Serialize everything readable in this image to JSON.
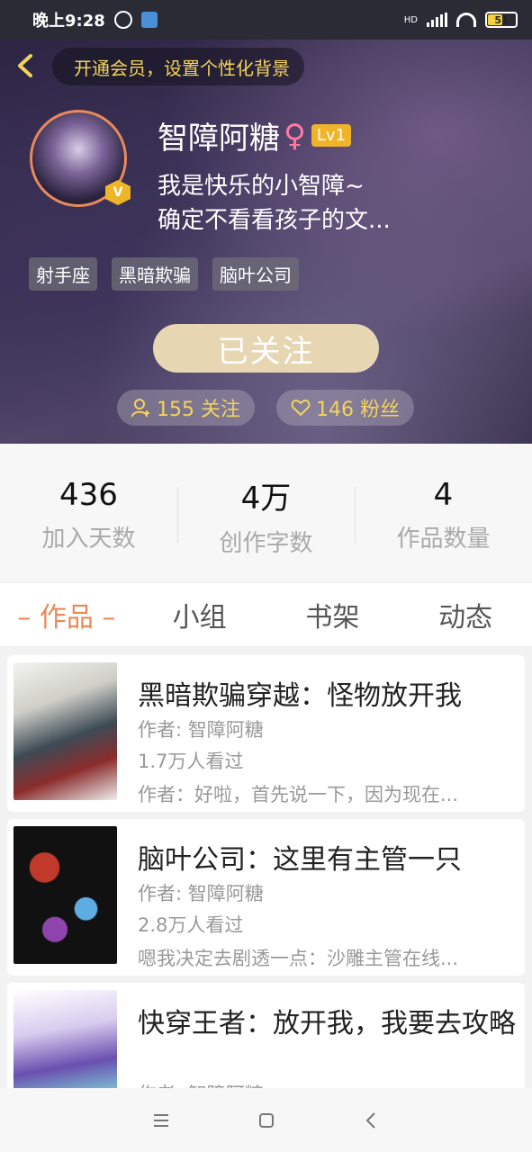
{
  "status_bar": {
    "time": "晚上9:28",
    "network": "HD",
    "battery": "51",
    "battery_level": 0.51
  },
  "header": {
    "vip_banner": "开通会员，设置个性化背景",
    "name": "智障阿糖",
    "gender_symbol": "♀",
    "level": "Lv1",
    "verified_badge": "V",
    "bio_line1": "我是快乐的小智障~",
    "bio_line2": "确定不看看孩子的文...",
    "tags": [
      "射手座",
      "黑暗欺骗",
      "脑叶公司"
    ],
    "follow_button": "已关注",
    "following_count": "155 关注",
    "fans_count": "146 粉丝"
  },
  "stats": [
    {
      "value": "436",
      "label": "加入天数"
    },
    {
      "value": "4万",
      "label": "创作字数"
    },
    {
      "value": "4",
      "label": "作品数量"
    }
  ],
  "tabs": [
    "– 作品 –",
    "小组",
    "书架",
    "动态"
  ],
  "works": [
    {
      "title": "黑暗欺骗穿越：怪物放开我",
      "author": "作者: 智障阿糖",
      "views": "1.7万人看过",
      "excerpt": "作者：好啦，首先说一下，因为现在..."
    },
    {
      "title": "脑叶公司：这里有主管一只",
      "author": "作者: 智障阿糖",
      "views": "2.8万人看过",
      "excerpt": "嗯我决定去剧透一点：沙雕主管在线..."
    },
    {
      "title": "快穿王者：放开我，我要去攻略",
      "author": "作者: 智障阿糖",
      "views": "",
      "excerpt": ""
    }
  ],
  "colors": {
    "accent": "#e8895b",
    "gold": "#f3d45a",
    "follow_button": "#e6d7b2"
  }
}
